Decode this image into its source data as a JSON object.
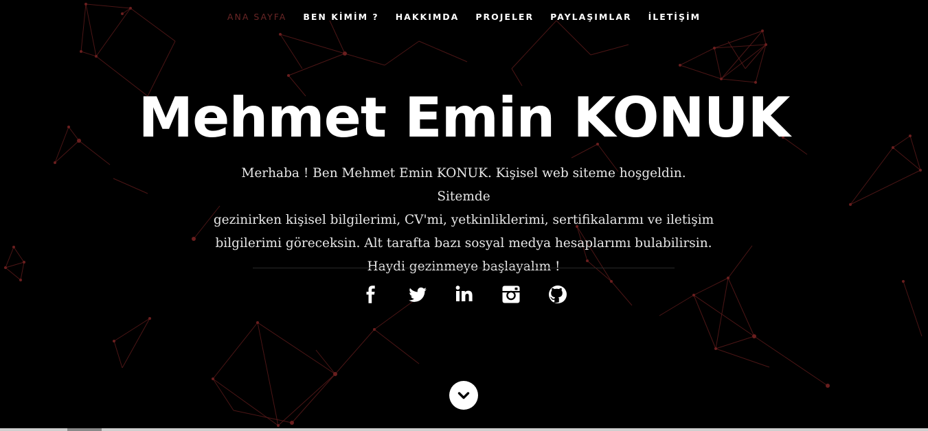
{
  "nav": {
    "items": [
      {
        "label": "ANA SAYFA",
        "active": true
      },
      {
        "label": "BEN KİMİM ?",
        "active": false
      },
      {
        "label": "HAKKIMDA",
        "active": false
      },
      {
        "label": "PROJELER",
        "active": false
      },
      {
        "label": "PAYLAŞIMLAR",
        "active": false
      },
      {
        "label": "İLETİŞİM",
        "active": false
      }
    ]
  },
  "hero": {
    "title": "Mehmet Emin KONUK",
    "intro_lines": [
      "Merhaba ! Ben Mehmet Emin KONUK. Kişisel web siteme hoşgeldin. Sitemde",
      "gezinirken kişisel bilgilerimi, CV'mi, yetkinliklerimi, sertifikalarımı ve iletişim",
      "bilgilerimi göreceksin. Alt tarafta bazı sosyal medya hesaplarımı bulabilirsin.",
      "Haydi gezinmeye başlayalım !"
    ]
  },
  "social": [
    {
      "icon": "facebook-icon"
    },
    {
      "icon": "twitter-icon"
    },
    {
      "icon": "linkedin-icon"
    },
    {
      "icon": "instagram-icon"
    },
    {
      "icon": "github-icon"
    }
  ],
  "scroll_down": {
    "icon": "chevron-down-icon"
  },
  "colors": {
    "background": "#000000",
    "nav_active": "#6a2626",
    "text": "#ffffff",
    "network_lines": "#5a1a1a"
  }
}
